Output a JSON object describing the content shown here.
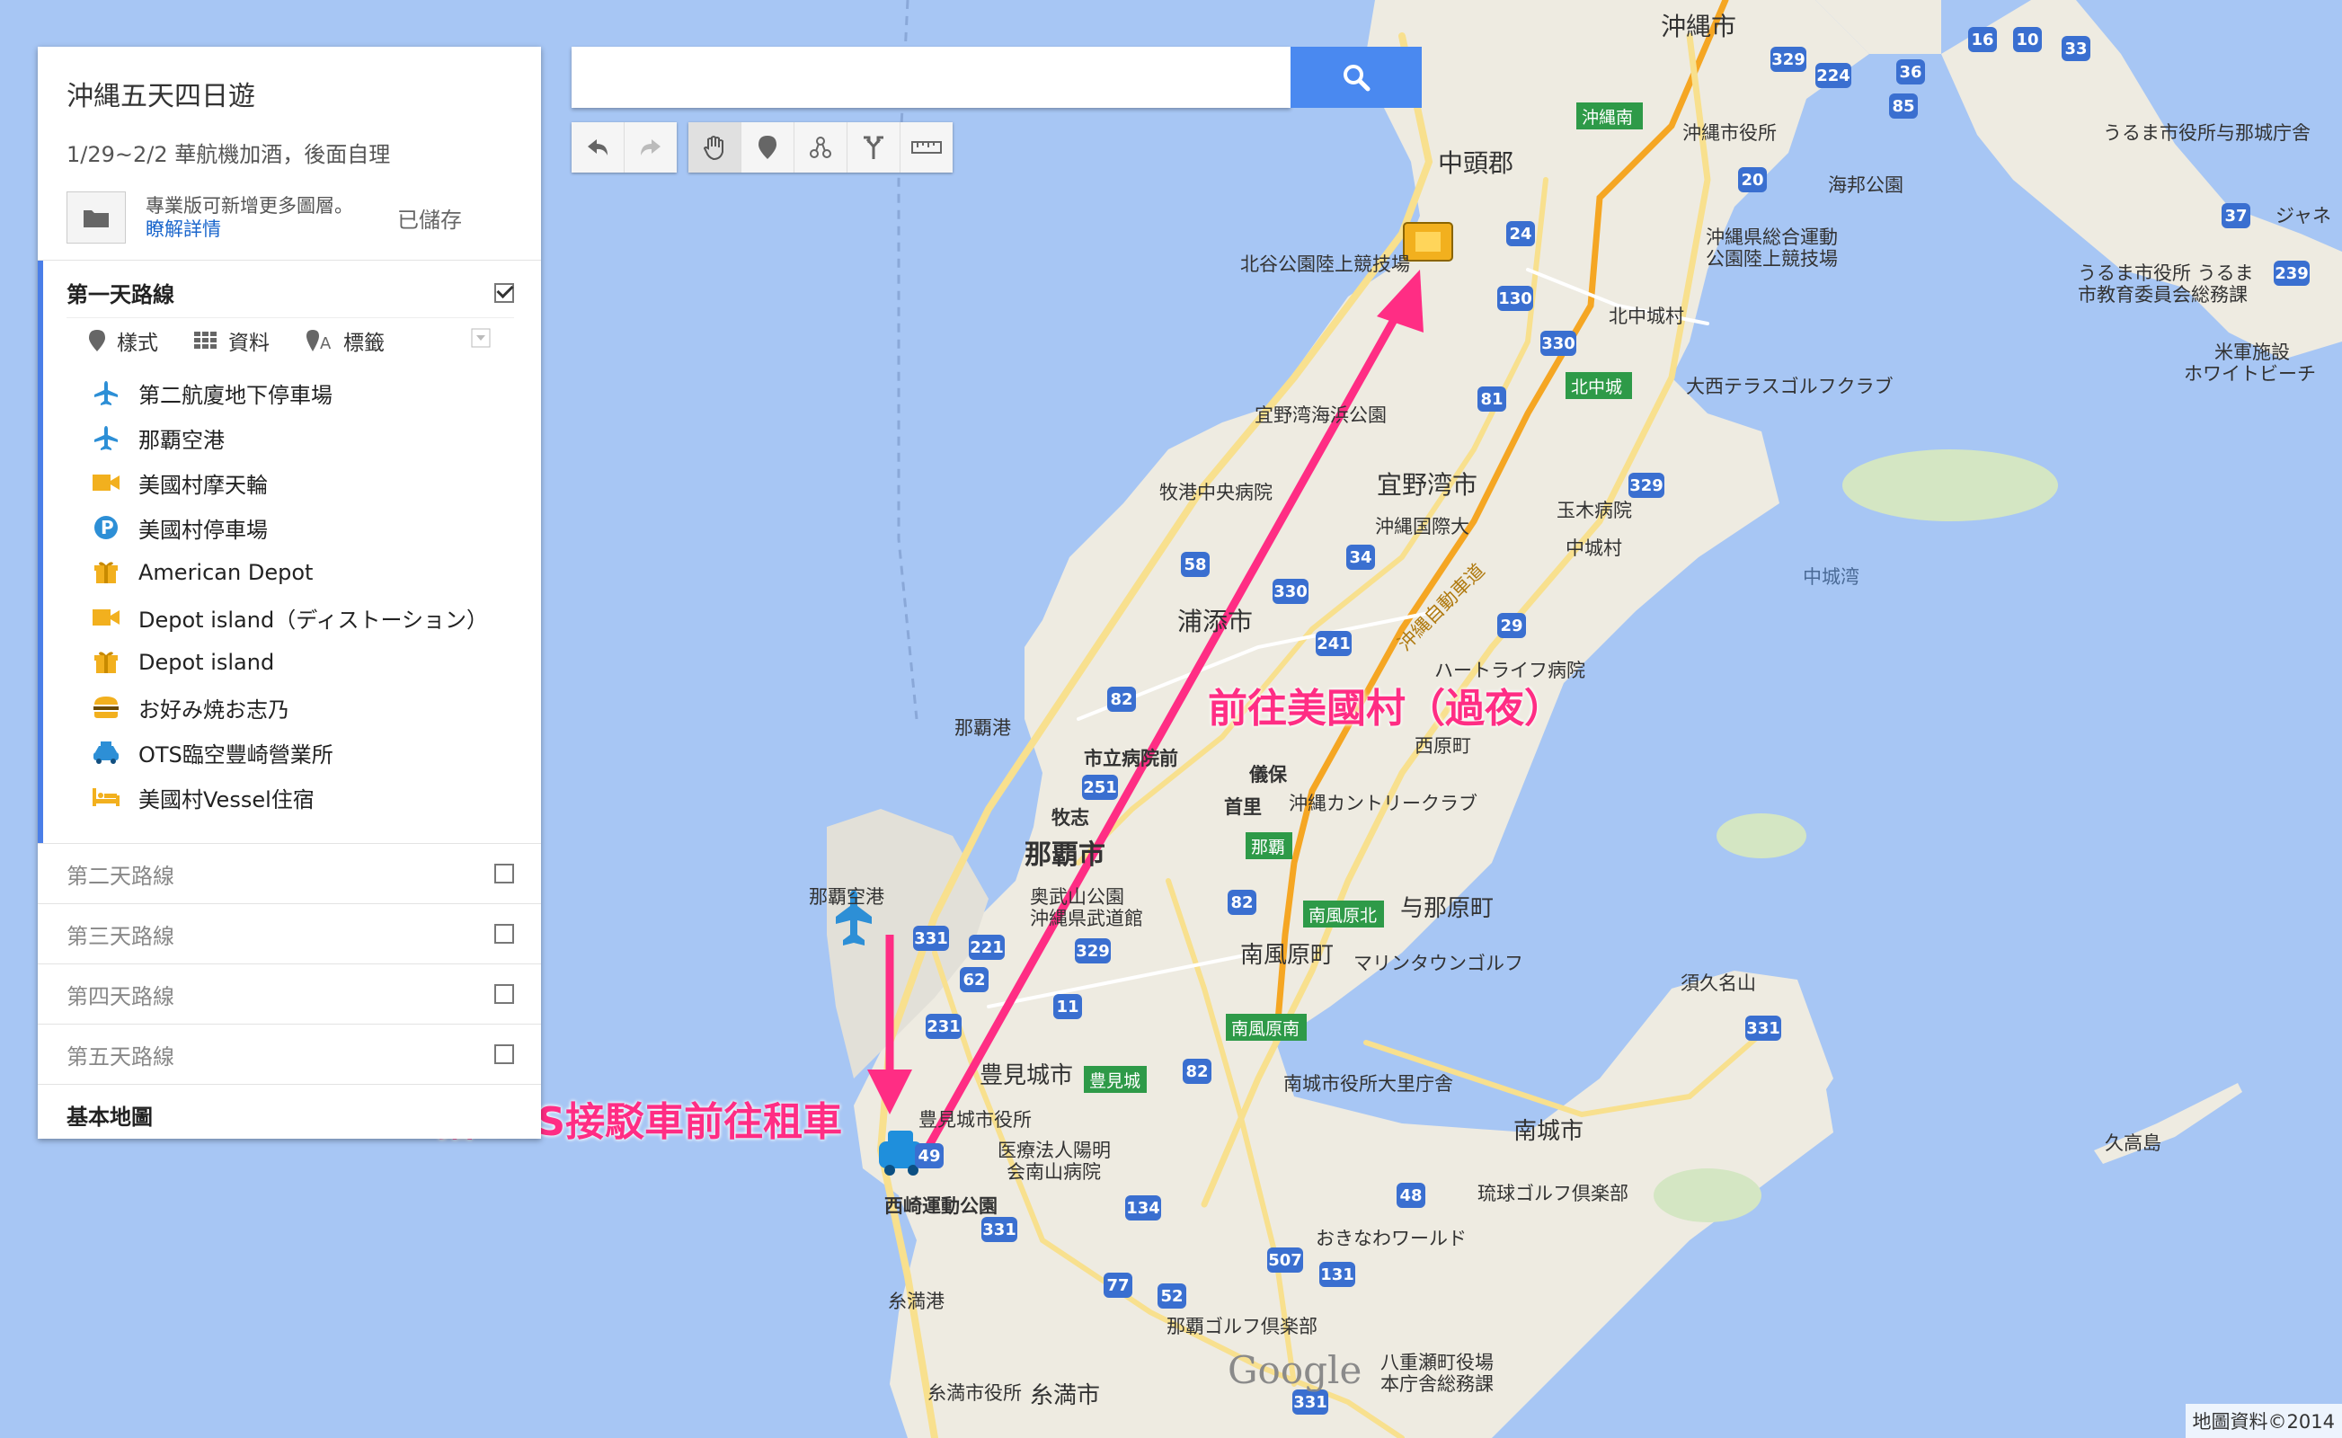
{
  "sidebar": {
    "map_title": "沖縄五天四日遊",
    "description": "1/29~2/2 華航機加酒，後面自理",
    "pro_notice": "專業版可新增更多圖層。",
    "learn_more": "瞭解詳情",
    "saved_status": "已儲存",
    "layer1": {
      "name": "第一天路線",
      "checked": true,
      "tools": [
        "樣式",
        "資料",
        "標籤"
      ],
      "items": [
        {
          "icon": "airplane-icon",
          "label": "第二航廈地下停車場"
        },
        {
          "icon": "airplane-icon",
          "label": "那覇空港"
        },
        {
          "icon": "video-camera-icon",
          "label": "美國村摩天輪"
        },
        {
          "icon": "parking-icon",
          "label": "美國村停車場"
        },
        {
          "icon": "gift-icon",
          "label": "American Depot"
        },
        {
          "icon": "video-camera-icon",
          "label": "Depot island（ディストーション）"
        },
        {
          "icon": "gift-icon",
          "label": "Depot island"
        },
        {
          "icon": "burger-icon",
          "label": "お好み焼お志乃"
        },
        {
          "icon": "taxi-icon",
          "label": "OTS臨空豐崎營業所"
        },
        {
          "icon": "hotel-bed-icon",
          "label": "美國村Vessel住宿"
        }
      ]
    },
    "other_layers": [
      "第二天路線",
      "第三天路線",
      "第四天路線",
      "第五天路線"
    ],
    "base_map": "基本地圖"
  },
  "search": {
    "placeholder": ""
  },
  "toolbar": [
    "undo-icon",
    "redo-icon",
    "hand-pan-icon",
    "add-marker-icon",
    "draw-line-icon",
    "directions-icon",
    "ruler-icon"
  ],
  "map": {
    "labels": {
      "okinawa_city": "沖縄市",
      "nakagami": "中頭郡",
      "okinawa_city_hall": "沖縄市役所",
      "hanta": "海邦公園",
      "sports_park": "沖縄県総合運動",
      "sports_park2": "公園陸上競技場",
      "kitanakagusuku": "北中城村",
      "kitanakagusuku_ic": "北中城",
      "okinawa_minami": "沖縄南",
      "daisei": "大西テラスゴルフクラブ",
      "uruma1": "うるま市役所与那城庁舎",
      "uruma2": "うるま市役所 うるま",
      "uruma3": "市教育委員会総務課",
      "beach1": "米軍施設",
      "beach2": "ホワイトビーチ",
      "janet": "ジャネ",
      "chatan_stadium": "北谷公園陸上競技場",
      "ginowan_port": "宜野湾海浜公園",
      "ginowan": "宜野湾市",
      "makiminato": "牧港中央病院",
      "okinawa_intl_univ": "沖縄国際大",
      "tamaki": "玉木病院",
      "nakagusuku": "中城村",
      "nakagusuku_bay": "中城湾",
      "urasoe": "浦添市",
      "expressway": "沖縄自動車道",
      "heart_life": "ハートライフ病院",
      "nishihara": "西原町",
      "naha_port": "那覇港",
      "city_hospital": "市立病院前",
      "gibo": "儀保",
      "shuri": "首里",
      "okinawa_country": "沖縄カントリークラブ",
      "makishi": "牧志",
      "naha_city": "那覇市",
      "naha_ic": "那覇",
      "onoyama1": "奥武山公園",
      "onoyama2": "沖縄県武道館",
      "naha_airport": "那覇空港",
      "haebaru_north": "南風原北",
      "yonabaru": "与那原町",
      "haebaru": "南風原町",
      "marine_town": "マリンタウンゴルフ",
      "haebaru_south": "南風原南",
      "tomigusuku": "豊見城市",
      "tomigusuku_ic": "豊見城",
      "tomigusuku_hall": "豊見城市役所",
      "nanbu_hospital1": "医療法人陽明",
      "nanbu_hospital2": "会南山病院",
      "nishizaki": "西崎運動公園",
      "nanjo_hall": "南城市役所大里庁舎",
      "nanjo": "南城市",
      "ryukyu_golf": "琉球ゴルフ倶楽部",
      "okinawa_world": "おきなわワールド",
      "itoman_port": "糸満港",
      "itoman_hall": "糸満市役所",
      "itoman": "糸満市",
      "naha_golf": "那覇ゴルフ倶楽部",
      "yaese1": "八重瀬町役場",
      "yaese2": "本庁舎総務課",
      "sueyoshi": "須久名山",
      "kudaka": "久高島"
    },
    "annotations": {
      "to_american_village": "前往美國村（過夜）",
      "shuttle": "搭OTS接駁車前往租車"
    },
    "google_logo": "Google",
    "copyright": "地圖資料©2014"
  },
  "colors": {
    "accent": "#4a7ee8",
    "annotation": "#ff2d84",
    "water": "#a7c6f4",
    "land": "#eeebe1"
  }
}
